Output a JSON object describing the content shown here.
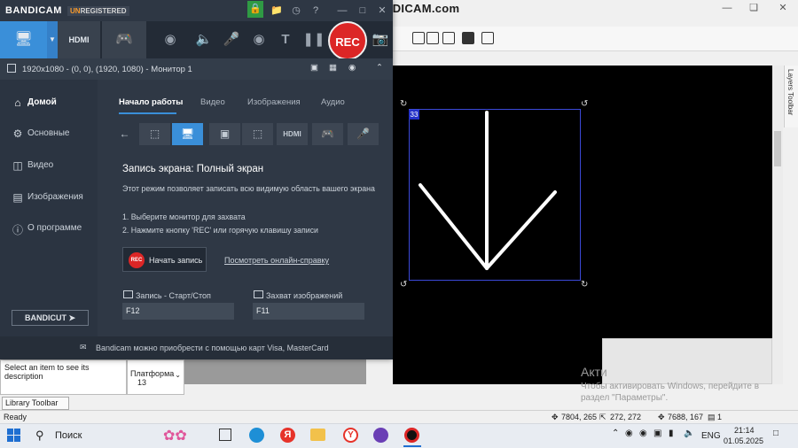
{
  "watermark": "www.BANDICAM.com",
  "bandicam": {
    "logo": "BANDICAM",
    "unreg_prefix": "UN",
    "unreg_rest": "REGISTERED",
    "rec_label": "REC",
    "info": "1920x1080 - (0, 0), (1920, 1080) - Монитор 1",
    "sidebar": [
      {
        "icon": "home-icon",
        "label": "Домой"
      },
      {
        "icon": "gear-icon",
        "label": "Основные"
      },
      {
        "icon": "video-icon",
        "label": "Видео"
      },
      {
        "icon": "image-icon",
        "label": "Изображения"
      },
      {
        "icon": "info-icon",
        "label": "О программе"
      }
    ],
    "bandicut": "BANDICUT",
    "tabs": [
      "Начало работы",
      "Видео",
      "Изображения",
      "Аудио"
    ],
    "heading": "Запись экрана: Полный экран",
    "description": "Этот режим позволяет записать всю видимую область вашего экрана",
    "step1": "1. Выберите монитор для захвата",
    "step2": "2. Нажмите кнопку 'REC' или горячую клавишу записи",
    "start_rec_icon": "REC",
    "start_rec_label": "Начать запись",
    "help_link": "Посмотреть онлайн-справку",
    "hotkey_rec_label": "Запись - Старт/Стоп",
    "hotkey_rec_value": "F12",
    "hotkey_img_label": "Захват изображений",
    "hotkey_img_value": "F11",
    "footer": "Bandicam можно приобрести с помощью карт Visa, MasterCard"
  },
  "editor": {
    "selection_number": "33",
    "layers_toolbar": "Layers Toolbar",
    "description_hint": "Select an item to see its description",
    "platform_label": "Платформа",
    "platform_value": "13",
    "library_toolbar": "Library Toolbar",
    "status_ready": "Ready",
    "coord1": "7804, 265",
    "coord2": "272, 272",
    "coord3": "7688, 167",
    "coord4": "1",
    "activate_title": "Акти",
    "activate_text": "Чтобы активировать Windows, перейдите в раздел \"Параметры\"."
  },
  "taskbar": {
    "search_placeholder": "Поиск",
    "lang": "ENG",
    "time": "21:14",
    "date": "01.05.2025"
  },
  "colors": {
    "accent": "#3a8fd9",
    "rec": "#dc2626",
    "bandicam_bg": "#2b3441"
  }
}
